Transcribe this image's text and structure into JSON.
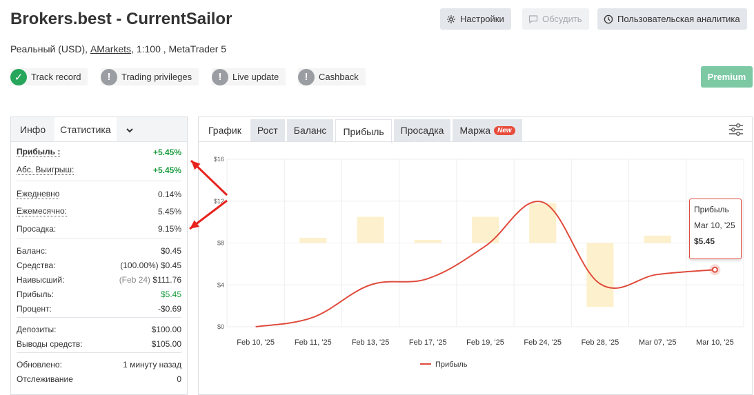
{
  "header": {
    "title": "Brokers.best - CurrentSailor",
    "subtitle_prefix": "Реальный (USD), ",
    "subtitle_link": "AMarkets",
    "subtitle_suffix": ", 1:100 , MetaTrader 5",
    "settings_label": "Настройки",
    "discuss_label": "Обсудить",
    "analytics_label": "Пользовательская аналитика"
  },
  "badges": [
    {
      "label": "Track record",
      "status": "check"
    },
    {
      "label": "Trading privileges",
      "status": "exclamation"
    },
    {
      "label": "Live update",
      "status": "exclamation"
    },
    {
      "label": "Cashback",
      "status": "exclamation"
    }
  ],
  "premium_label": "Premium",
  "left_panel": {
    "tabs": [
      "Инфо",
      "Статистика"
    ],
    "active_tab": "Статистика",
    "rows": {
      "profit_label": "Прибыль :",
      "profit_value": "+5.45%",
      "abs_label": "Абс. Выигрыш:",
      "abs_value": "+5.45%",
      "daily_label": "Ежедневно",
      "daily_value": "0.14%",
      "monthly_label": "Ежемесячно:",
      "monthly_value": "5.45%",
      "drawdown_label": "Просадка:",
      "drawdown_value": "9.15%",
      "balance_label": "Баланс:",
      "balance_value": "$0.45",
      "equity_label": "Средства:",
      "equity_pct": "(100.00%)",
      "equity_value": "$0.45",
      "highest_label": "Наивысший:",
      "highest_date": "(Feb 24)",
      "highest_value": "$111.76",
      "profit2_label": "Прибыль:",
      "profit2_value": "$5.45",
      "percent_label": "Процент:",
      "percent_value": "-$0.69",
      "deposits_label": "Депозиты:",
      "deposits_value": "$100.00",
      "withdrawals_label": "Выводы средств:",
      "withdrawals_value": "$105.00",
      "updated_label": "Обновлено:",
      "updated_value": "1 минуту назад",
      "tracking_label": "Отслеживание",
      "tracking_value": "0"
    }
  },
  "right_panel": {
    "tabs": [
      {
        "label": "График",
        "style": "plain"
      },
      {
        "label": "Рост",
        "style": "normal"
      },
      {
        "label": "Баланс",
        "style": "normal"
      },
      {
        "label": "Прибыль",
        "style": "active"
      },
      {
        "label": "Просадка",
        "style": "normal"
      },
      {
        "label": "Маржа",
        "style": "normal",
        "badge": "New"
      }
    ]
  },
  "tooltip": {
    "series": "Прибыль",
    "date": "Mar 10, '25",
    "value": "$5.45"
  },
  "colors": {
    "line": "#e04b3c",
    "bar": "#fdf0cc",
    "green": "#1a9b3e",
    "premium": "#7cc9a4"
  },
  "chart_data": {
    "type": "line",
    "categories": [
      "Feb 10, '25",
      "Feb 11, '25",
      "Feb 13, '25",
      "Feb 17, '25",
      "Feb 19, '25",
      "Feb 24, '25",
      "Feb 28, '25",
      "Mar 07, '25",
      "Mar 10, '25"
    ],
    "y_ticks": [
      "$0",
      "$4",
      "$8",
      "$12",
      "$16"
    ],
    "ylim": [
      0,
      16
    ],
    "grid": true,
    "legend": "bottom",
    "series": [
      {
        "name": "Прибыль",
        "type": "line",
        "values": [
          0.0,
          0.9,
          4.0,
          4.6,
          7.7,
          11.9,
          4.1,
          5.0,
          5.45
        ]
      }
    ],
    "bars": {
      "categories": [
        "Feb 11, '25",
        "Feb 13, '25",
        "Feb 17, '25",
        "Feb 19, '25",
        "Feb 24, '25",
        "Feb 28, '25",
        "Mar 07, '25"
      ],
      "ranges": [
        [
          8.0,
          8.5
        ],
        [
          8.0,
          10.5
        ],
        [
          8.0,
          8.3
        ],
        [
          8.0,
          10.5
        ],
        [
          8.0,
          11.8
        ],
        [
          1.9,
          8.0
        ],
        [
          8.0,
          8.7
        ]
      ]
    }
  }
}
